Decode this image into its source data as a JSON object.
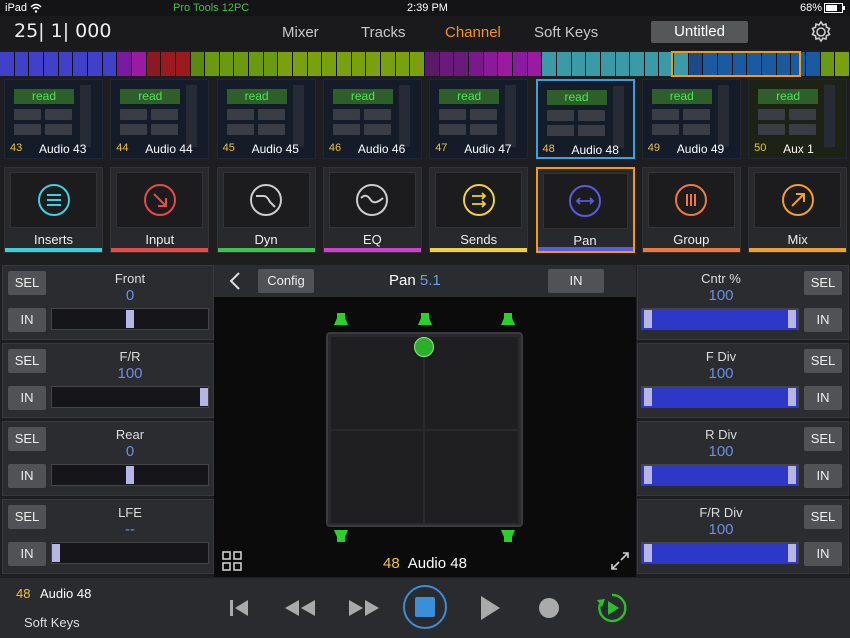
{
  "status_bar": {
    "device": "iPad",
    "wifi_icon": "wifi-icon",
    "app_name": "Pro Tools 12PC",
    "time": "2:39 PM",
    "battery": "68%",
    "battery_icon": "battery-icon"
  },
  "nav": {
    "timecode": "25| 1| 000",
    "tabs": [
      {
        "label": "Mixer"
      },
      {
        "label": "Tracks"
      },
      {
        "label": "Channel",
        "active": true
      },
      {
        "label": "Soft Keys"
      }
    ],
    "session": "Untitled",
    "settings_icon": "gear-icon",
    "active_color": "#f7931e"
  },
  "tracks": [
    {
      "num": "43",
      "name": "Audio 43",
      "auto": "read"
    },
    {
      "num": "44",
      "name": "Audio 44",
      "auto": "read"
    },
    {
      "num": "45",
      "name": "Audio 45",
      "auto": "read"
    },
    {
      "num": "46",
      "name": "Audio 46",
      "auto": "read"
    },
    {
      "num": "47",
      "name": "Audio 47",
      "auto": "read"
    },
    {
      "num": "48",
      "name": "Audio 48",
      "auto": "read",
      "selected": true
    },
    {
      "num": "49",
      "name": "Audio 49",
      "auto": "read"
    },
    {
      "num": "50",
      "name": "Aux 1",
      "auto": "read"
    }
  ],
  "functions": [
    {
      "label": "Inserts",
      "icon": "list-icon",
      "color": "#3fd0e0"
    },
    {
      "label": "Input",
      "icon": "input-arrow-icon",
      "color": "#e84a4a"
    },
    {
      "label": "Dyn",
      "icon": "dynamics-curve-icon",
      "color": "#3fc34a"
    },
    {
      "label": "EQ",
      "icon": "eq-wave-icon",
      "color": "#d040d0"
    },
    {
      "label": "Sends",
      "icon": "sends-arrows-icon",
      "color": "#f0d040"
    },
    {
      "label": "Pan",
      "icon": "pan-arrows-icon",
      "color": "#5a5ae0",
      "selected": true
    },
    {
      "label": "Group",
      "icon": "group-bars-icon",
      "color": "#f07840"
    },
    {
      "label": "Mix",
      "icon": "mix-arrow-icon",
      "color": "#f0a030"
    }
  ],
  "left_controls": [
    {
      "title": "Front",
      "value": "0",
      "sel": "SEL",
      "in": "IN",
      "level": 0.5
    },
    {
      "title": "F/R",
      "value": "100",
      "sel": "SEL",
      "in": "IN",
      "level": 1.0
    },
    {
      "title": "Rear",
      "value": "0",
      "sel": "SEL",
      "in": "IN",
      "level": 0.5
    },
    {
      "title": "LFE",
      "value": "--",
      "sel": "SEL",
      "in": "IN",
      "level": 0.0
    }
  ],
  "right_controls": [
    {
      "title": "Cntr %",
      "value": "100",
      "sel": "SEL",
      "in": "IN",
      "level": 1.0
    },
    {
      "title": "F Div",
      "value": "100",
      "sel": "SEL",
      "in": "IN",
      "level": 1.0
    },
    {
      "title": "R Div",
      "value": "100",
      "sel": "SEL",
      "in": "IN",
      "level": 1.0
    },
    {
      "title": "F/R Div",
      "value": "100",
      "sel": "SEL",
      "in": "IN",
      "level": 1.0
    }
  ],
  "pan": {
    "back_icon": "chevron-left-icon",
    "config": "Config",
    "title": "Pan",
    "format": "5.1",
    "in": "IN",
    "track_num": "48",
    "track_name": "Audio 48",
    "grid_icon": "grid-icon",
    "expand_icon": "expand-icon"
  },
  "footer": {
    "track_num": "48",
    "track_name": "Audio 48",
    "soft_keys": "Soft Keys"
  },
  "transport": [
    "rewind-to-start-icon",
    "rewind-icon",
    "fast-forward-icon",
    "stop-icon",
    "play-icon",
    "record-icon",
    "loop-play-icon"
  ]
}
